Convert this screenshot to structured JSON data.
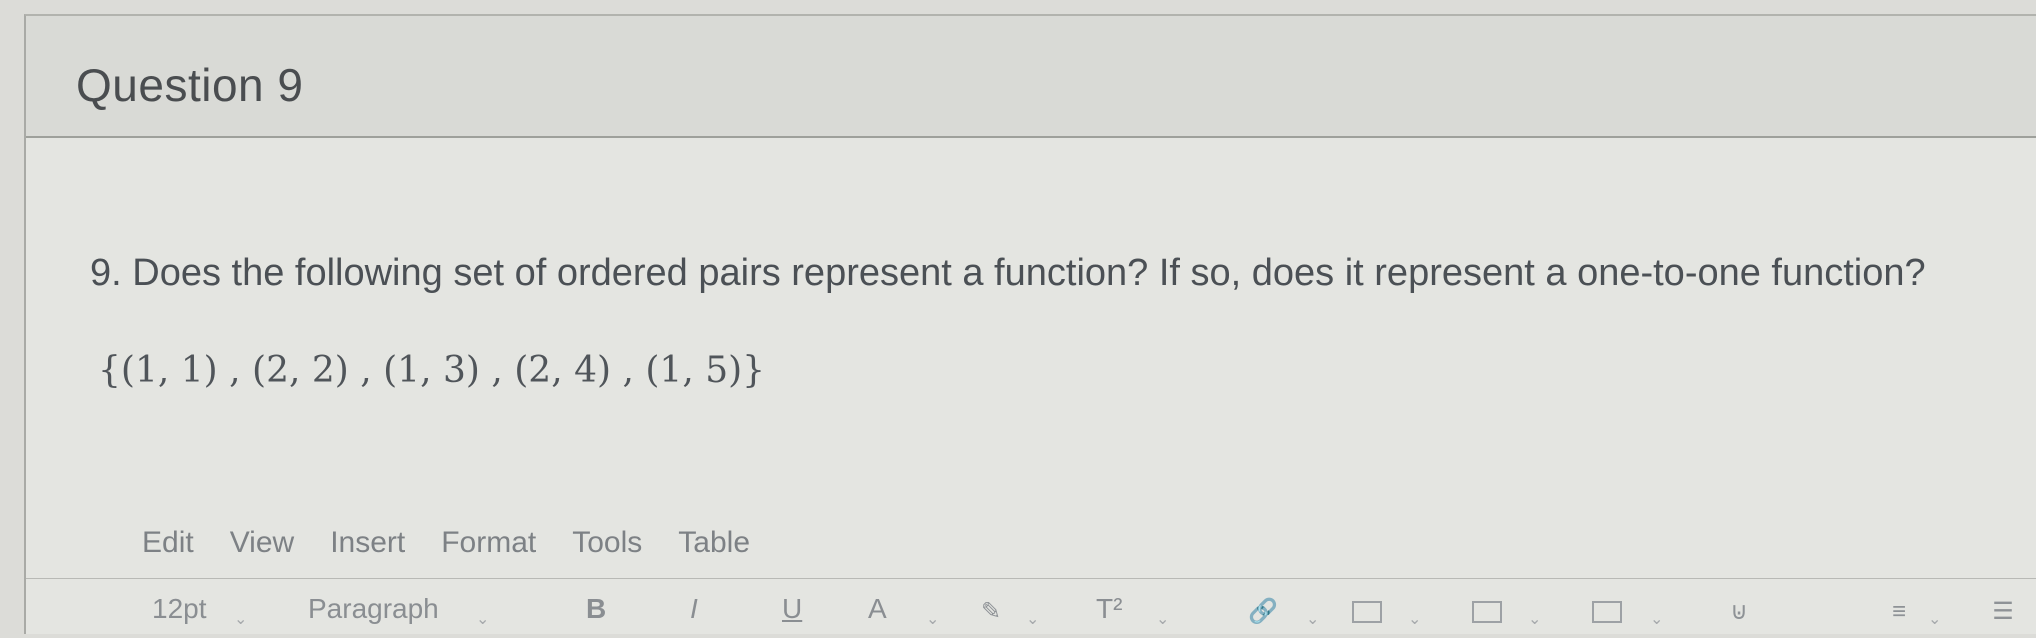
{
  "question": {
    "title": "Question 9",
    "prompt": "9. Does the following set of ordered pairs represent a function? If so, does it represent a one-to-one function?",
    "math": "{(1, 1) , (2, 2) , (1, 3) , (2, 4) , (1, 5)}"
  },
  "editor": {
    "menu": [
      "Edit",
      "View",
      "Insert",
      "Format",
      "Tools",
      "Table"
    ],
    "toolbar": {
      "font_size": "12pt",
      "block_format": "Paragraph",
      "bold": "B",
      "italic": "I",
      "underline": "U",
      "text_color": "A",
      "superscript": "T²"
    },
    "icons": [
      "chevron-down-icon",
      "bold-icon",
      "italic-icon",
      "underline-icon",
      "text-color-icon",
      "highlight-icon",
      "superscript-icon",
      "link-icon",
      "image-icon",
      "media-icon",
      "document-icon",
      "embed-icon",
      "align-icon",
      "list-icon"
    ]
  }
}
